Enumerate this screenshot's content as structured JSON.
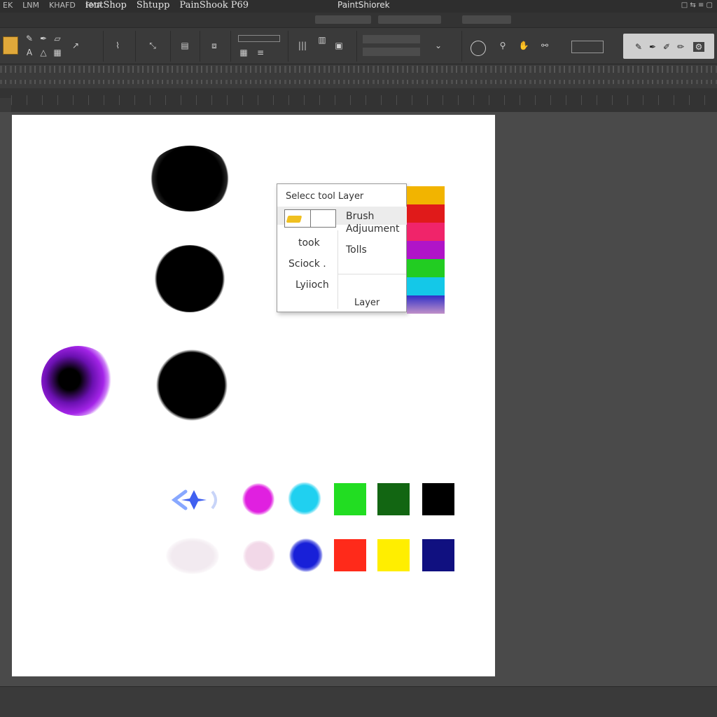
{
  "titlebar": {
    "menu": [
      "EK",
      "LNM",
      "KHAFD",
      "FMA"
    ],
    "app_names": [
      "ientShop",
      "Shtupp",
      "PainShook P69"
    ],
    "doc_title": "PaintShiorek",
    "window_controls": "□ ⇆ ≡ ▢"
  },
  "popup": {
    "title": "Selecc tool Layer",
    "right_items": [
      "Brush",
      "Adjuument",
      "Tolls",
      "Layer"
    ],
    "left_items": [
      "took",
      "Sciock .",
      "Lyiioch"
    ]
  },
  "colors": {
    "strip": [
      "#f2b400",
      "#e01a1a",
      "#f0246a",
      "#b014c8",
      "#22cc22",
      "#14c8e8",
      "#3030c8"
    ],
    "swatches_row1": [
      "#22dd22",
      "#126612",
      "#000000"
    ],
    "swatches_row2": [
      "#ff2a1a",
      "#ffee00",
      "#101080"
    ],
    "blobs": {
      "magenta": "#e020e0",
      "cyan": "#20d0f0",
      "blue": "#1820d8",
      "purple": "#9a20e0",
      "pale": "#f2d8e8"
    }
  },
  "icons": {
    "toolbar": [
      "brush-icon",
      "pen-icon",
      "eraser-icon",
      "text-icon",
      "shape-icon",
      "grid-icon",
      "layers-icon",
      "lasso-icon",
      "stamp-icon",
      "hand-icon",
      "zoom-icon"
    ]
  }
}
